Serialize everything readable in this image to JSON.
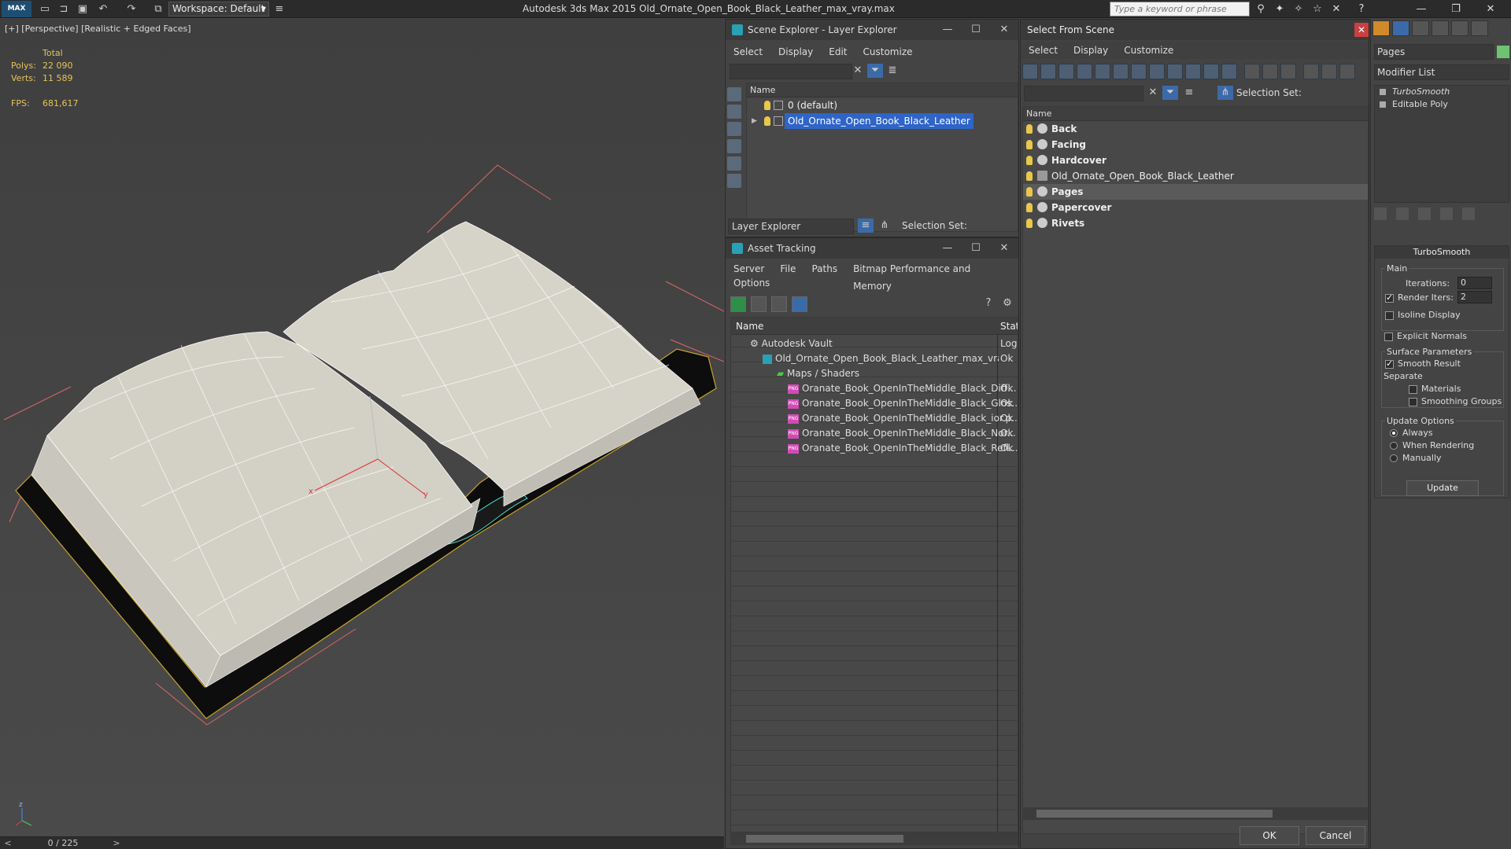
{
  "titlebar": {
    "logo": "MAX",
    "workspace": "Workspace: Default",
    "app_title": "Autodesk 3ds Max  2015    Old_Ornate_Open_Book_Black_Leather_max_vray.max",
    "search_placeholder": "Type a keyword or phrase"
  },
  "viewport": {
    "label": "[+] [Perspective] [Realistic + Edged Faces]",
    "stats": {
      "total_label": "Total",
      "polys_label": "Polys:",
      "polys": "22 090",
      "verts_label": "Verts:",
      "verts": "11 589",
      "fps_label": "FPS:",
      "fps": "681,617"
    },
    "axis_labels": {
      "x": "x",
      "y": "y",
      "z": "z"
    }
  },
  "timeline": {
    "counter": "0 / 225",
    "prev": "<",
    "next": ">"
  },
  "scene_explorer": {
    "title": "Scene Explorer - Layer Explorer",
    "menu": [
      "Select",
      "Display",
      "Edit",
      "Customize"
    ],
    "column": "Name",
    "layers": [
      {
        "label": "0 (default)",
        "selected": false
      },
      {
        "label": "Old_Ornate_Open_Book_Black_Leather",
        "selected": true
      }
    ],
    "footer_dropdown": "Layer Explorer",
    "selection_set_label": "Selection Set:"
  },
  "asset_tracking": {
    "title": "Asset Tracking",
    "menu": [
      "Server",
      "File",
      "Paths",
      "Bitmap Performance and Memory"
    ],
    "menu2": [
      "Options"
    ],
    "col_name": "Name",
    "col_status": "Stat",
    "rows": [
      {
        "name": "Autodesk Vault",
        "status": "Log",
        "indent": 0
      },
      {
        "name": "Old_Ornate_Open_Book_Black_Leather_max_vray....",
        "status": "Ok",
        "indent": 1
      },
      {
        "name": "Maps / Shaders",
        "status": "",
        "indent": 2
      },
      {
        "name": "Oranate_Book_OpenInTheMiddle_Black_Diff...",
        "status": "Ok",
        "indent": 3
      },
      {
        "name": "Oranate_Book_OpenInTheMiddle_Black_Glos...",
        "status": "Ok",
        "indent": 3
      },
      {
        "name": "Oranate_Book_OpenInTheMiddle_Black_ior.p...",
        "status": "Ok",
        "indent": 3
      },
      {
        "name": "Oranate_Book_OpenInTheMiddle_Black_Nor...",
        "status": "Ok",
        "indent": 3
      },
      {
        "name": "Oranate_Book_OpenInTheMiddle_Black_Refl...",
        "status": "Ok",
        "indent": 3
      }
    ],
    "png_label": "PNG"
  },
  "select_from_scene": {
    "title": "Select From Scene",
    "menu": [
      "Select",
      "Display",
      "Customize"
    ],
    "selection_set_label": "Selection Set:",
    "column": "Name",
    "objects": [
      {
        "label": "Back",
        "bold": true,
        "selected": false
      },
      {
        "label": "Facing",
        "bold": true,
        "selected": false
      },
      {
        "label": "Hardcover",
        "bold": true,
        "selected": false
      },
      {
        "label": "Old_Ornate_Open_Book_Black_Leather",
        "bold": false,
        "selected": false
      },
      {
        "label": "Pages",
        "bold": true,
        "selected": true
      },
      {
        "label": "Papercover",
        "bold": true,
        "selected": false
      },
      {
        "label": "Rivets",
        "bold": true,
        "selected": false
      }
    ],
    "ok": "OK",
    "cancel": "Cancel"
  },
  "command_panel": {
    "object_name": "Pages",
    "object_color": "#6ec270",
    "modifier_list": "Modifier List",
    "stack": [
      {
        "label": "TurboSmooth",
        "italic": true
      },
      {
        "label": "Editable Poly",
        "italic": false
      }
    ],
    "rollout_title": "TurboSmooth",
    "main_label": "Main",
    "iterations_label": "Iterations:",
    "iterations": "0",
    "render_iters_label": "Render Iters:",
    "render_iters": "2",
    "render_iters_checked": true,
    "isoline_label": "Isoline Display",
    "explicit_normals_label": "Explicit Normals",
    "surface_params_label": "Surface Parameters",
    "smooth_result_label": "Smooth Result",
    "separate_label": "Separate",
    "materials_label": "Materials",
    "smoothing_groups_label": "Smoothing Groups",
    "update_options_label": "Update Options",
    "always_label": "Always",
    "when_rendering_label": "When Rendering",
    "manually_label": "Manually",
    "update_button": "Update"
  }
}
